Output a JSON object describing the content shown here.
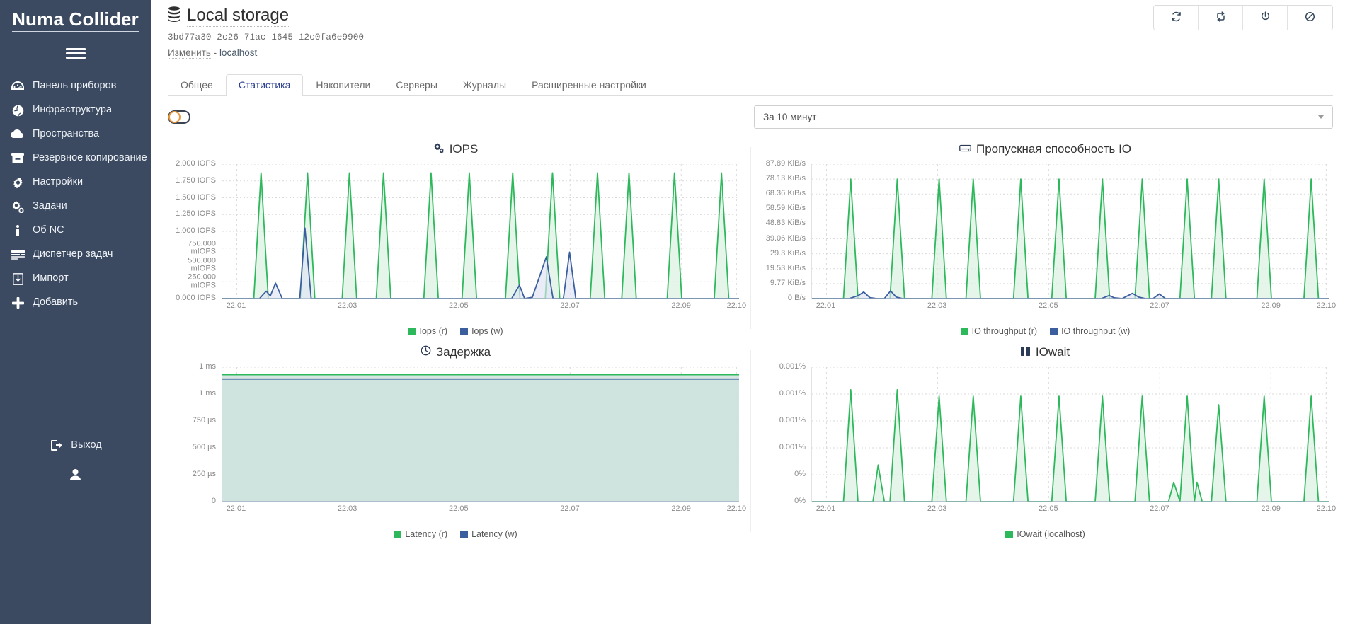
{
  "sidebar": {
    "brand": "Numa Collider",
    "menu_icon": "hamburger-icon",
    "items": [
      {
        "label": "Панель приборов",
        "icon": "dashboard-icon"
      },
      {
        "label": "Инфраструктура",
        "icon": "globe-icon"
      },
      {
        "label": "Пространства",
        "icon": "cloud-icon"
      },
      {
        "label": "Резервное копирование",
        "icon": "archive-icon"
      },
      {
        "label": "Настройки",
        "icon": "gear-icon"
      },
      {
        "label": "Задачи",
        "icon": "gears-icon"
      },
      {
        "label": "Об NC",
        "icon": "info-icon"
      },
      {
        "label": "Диспетчер задач",
        "icon": "tasks-icon"
      },
      {
        "label": "Импорт",
        "icon": "import-icon"
      },
      {
        "label": "Добавить",
        "icon": "plus-icon"
      }
    ],
    "logout": {
      "label": "Выход",
      "icon": "logout-icon"
    },
    "user": {
      "icon": "user-icon"
    }
  },
  "header": {
    "title": "Local storage",
    "title_icon": "database-icon",
    "uuid": "3bd77a30-2c26-71ac-1645-12c0fa6e9900",
    "edit_label": "Изменить",
    "separator": "-",
    "host": "localhost",
    "toolbar": [
      {
        "name": "refresh-button",
        "icon": "sync-icon"
      },
      {
        "name": "migrate-button",
        "icon": "repeat-icon"
      },
      {
        "name": "power-button",
        "icon": "power-icon"
      },
      {
        "name": "disable-button",
        "icon": "ban-icon"
      }
    ]
  },
  "tabs": [
    {
      "label": "Общее",
      "active": false
    },
    {
      "label": "Статистика",
      "active": true
    },
    {
      "label": "Накопители",
      "active": false
    },
    {
      "label": "Серверы",
      "active": false
    },
    {
      "label": "Журналы",
      "active": false
    },
    {
      "label": "Расширенные настройки",
      "active": false
    }
  ],
  "controls": {
    "toggle": {
      "name": "compact-toggle",
      "state": "off"
    },
    "range": {
      "value": "За 10 минут"
    }
  },
  "colors": {
    "green": "#2eb85c",
    "green_fill": "#d8f0de",
    "blue": "#3b5f9e",
    "blue_fill": "#dfe4f2",
    "latency_fill": "#cfe3de",
    "sidebar": "#3b4a61",
    "accent": "#2a3f8f",
    "toggle_accent": "#e8973c"
  },
  "chart_data": [
    {
      "id": "iops",
      "type": "area",
      "title": "IOPS",
      "title_icon": "gears-icon",
      "ylabels": [
        "2.000 IOPS",
        "1.750 IOPS",
        "1.500 IOPS",
        "1.250 IOPS",
        "1.000 IOPS",
        "750.000\nmIOPS",
        "500.000\nmIOPS",
        "250.000\nmIOPS",
        "0.000 IOPS"
      ],
      "ylim": [
        0,
        2
      ],
      "xlabels": [
        "22:01",
        "22:03",
        "22:05",
        "22:07",
        "22:09",
        "22:10"
      ],
      "xlabel_pos": [
        0.028,
        0.243,
        0.458,
        0.673,
        0.888,
        0.995
      ],
      "grid": true,
      "legend_position": "bottom",
      "series": [
        {
          "name": "Iops (r)",
          "color": "#2eb85c",
          "peaks_x": [
            0.075,
            0.165,
            0.246,
            0.312,
            0.404,
            0.478,
            0.562,
            0.639,
            0.726,
            0.787,
            0.875,
            0.966
          ],
          "peak_value": 1.87,
          "half_width": 0.014
        },
        {
          "name": "Iops (w)",
          "color": "#3b5f9e",
          "points": [
            [
              0.072,
              0.0
            ],
            [
              0.085,
              0.11
            ],
            [
              0.093,
              0.04
            ],
            [
              0.103,
              0.23
            ],
            [
              0.116,
              0.0
            ],
            [
              0.15,
              0.0
            ],
            [
              0.16,
              1.05
            ],
            [
              0.172,
              0.0
            ],
            [
              0.185,
              0.0
            ],
            [
              0.56,
              0.0
            ],
            [
              0.575,
              0.2
            ],
            [
              0.585,
              0.0
            ],
            [
              0.6,
              0.02
            ],
            [
              0.627,
              0.62
            ],
            [
              0.64,
              0.0
            ],
            [
              0.65,
              0.0
            ],
            [
              0.66,
              0.0
            ],
            [
              0.672,
              0.69
            ],
            [
              0.684,
              0.0
            ],
            [
              0.7,
              0.0
            ]
          ]
        }
      ]
    },
    {
      "id": "io-throughput",
      "type": "area",
      "title": "Пропускная способность IO",
      "title_icon": "hdd-icon",
      "ylabels": [
        "87.89 KiB/s",
        "78.13 KiB/s",
        "68.36 KiB/s",
        "58.59 KiB/s",
        "48.83 KiB/s",
        "39.06 KiB/s",
        "29.3 KiB/s",
        "19.53 KiB/s",
        "9.77 KiB/s",
        "0 B/s"
      ],
      "ylim": [
        0,
        87.89
      ],
      "xlabels": [
        "22:01",
        "22:03",
        "22:05",
        "22:07",
        "22:09",
        "22:10"
      ],
      "xlabel_pos": [
        0.028,
        0.243,
        0.458,
        0.673,
        0.888,
        0.995
      ],
      "grid": true,
      "legend_position": "bottom",
      "series": [
        {
          "name": "IO throughput (r)",
          "color": "#2eb85c",
          "peaks_x": [
            0.075,
            0.165,
            0.246,
            0.312,
            0.404,
            0.478,
            0.562,
            0.639,
            0.726,
            0.787,
            0.875,
            0.966
          ],
          "peak_value": 78.13,
          "half_width": 0.014
        },
        {
          "name": "IO throughput (w)",
          "color": "#3b5f9e",
          "points": [
            [
              0.072,
              0
            ],
            [
              0.09,
              2.0
            ],
            [
              0.1,
              4.3
            ],
            [
              0.112,
              0.6
            ],
            [
              0.125,
              0
            ],
            [
              0.14,
              0
            ],
            [
              0.152,
              5.0
            ],
            [
              0.163,
              1.0
            ],
            [
              0.175,
              0
            ],
            [
              0.56,
              0
            ],
            [
              0.575,
              2.0
            ],
            [
              0.585,
              0.5
            ],
            [
              0.6,
              0
            ],
            [
              0.62,
              3.4
            ],
            [
              0.632,
              1.0
            ],
            [
              0.645,
              0
            ],
            [
              0.66,
              0
            ],
            [
              0.672,
              3.0
            ],
            [
              0.684,
              0
            ],
            [
              0.7,
              0
            ]
          ]
        }
      ]
    },
    {
      "id": "latency",
      "type": "area",
      "title": "Задержка",
      "title_icon": "clock-icon",
      "ylabels": [
        "1 ms",
        "1 ms",
        "750 µs",
        "500 µs",
        "250 µs",
        "0"
      ],
      "ylim": [
        0,
        1250
      ],
      "xlabels": [
        "22:01",
        "22:03",
        "22:05",
        "22:07",
        "22:09",
        "22:10"
      ],
      "xlabel_pos": [
        0.028,
        0.243,
        0.458,
        0.673,
        0.888,
        0.995
      ],
      "grid": true,
      "legend_position": "bottom",
      "series": [
        {
          "name": "Latency (r)",
          "color": "#2eb85c",
          "constant": 1180
        },
        {
          "name": "Latency (w)",
          "color": "#3b5f9e",
          "constant": 1140
        }
      ]
    },
    {
      "id": "iowait",
      "type": "area",
      "title": "IOwait",
      "title_icon": "pause-icon",
      "ylabels": [
        "0.001%",
        "0.001%",
        "0.001%",
        "0.001%",
        "0%",
        "0%"
      ],
      "ylim": [
        0,
        0.00125
      ],
      "xlabels": [
        "22:01",
        "22:03",
        "22:05",
        "22:07",
        "22:09",
        "22:10"
      ],
      "xlabel_pos": [
        0.028,
        0.243,
        0.458,
        0.673,
        0.888,
        0.995
      ],
      "grid": true,
      "legend_position": "bottom",
      "series": [
        {
          "name": "IOwait (localhost)",
          "color": "#2eb85c",
          "peaks_x": [
            0.075,
            0.165,
            0.246,
            0.312,
            0.404,
            0.478,
            0.562,
            0.639,
            0.726,
            0.787,
            0.875,
            0.966
          ],
          "peak_values": [
            0.00104,
            0.00104,
            0.00098,
            0.00098,
            0.00098,
            0.00098,
            0.00098,
            0.00098,
            0.00098,
            0.0009,
            0.00098,
            0.00098
          ],
          "half_width": 0.014,
          "extra_points": [
            [
              0.118,
              0
            ],
            [
              0.128,
              0.00034
            ],
            [
              0.14,
              0
            ],
            [
              0.69,
              0
            ],
            [
              0.7,
              0.00018
            ],
            [
              0.745,
              0.00018
            ],
            [
              0.755,
              0
            ]
          ]
        }
      ]
    }
  ]
}
